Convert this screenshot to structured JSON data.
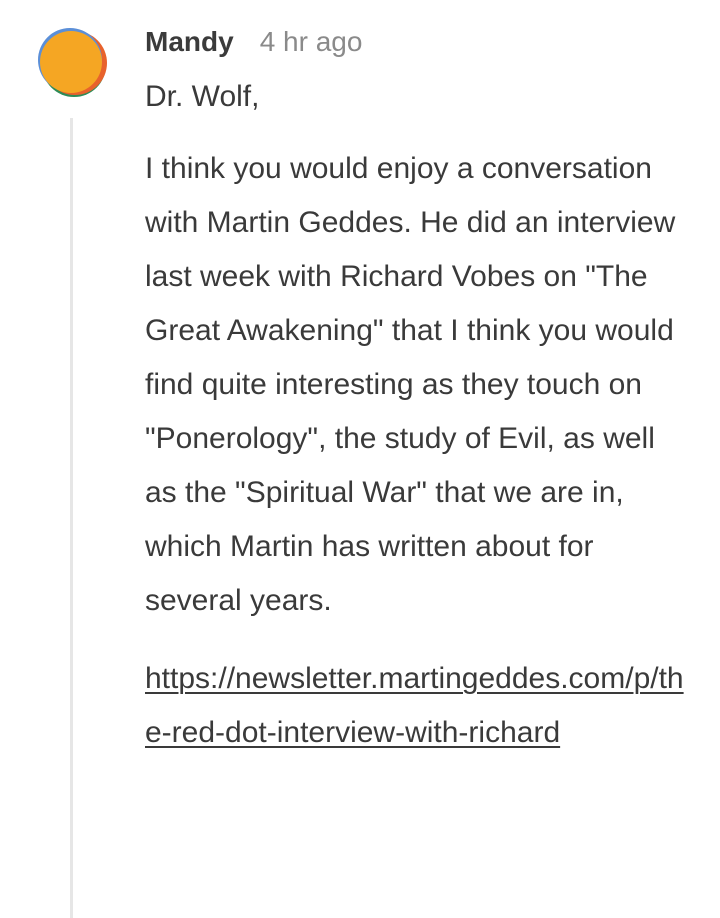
{
  "comment": {
    "author": "Mandy",
    "timestamp": "4 hr ago",
    "greeting": "Dr. Wolf,",
    "body": "I think you would enjoy a conversation with Martin Geddes. He did an interview last week with Richard Vobes on \"The Great Awakening\" that I think you would find quite interesting as they touch on \"Ponerology\", the study of Evil, as well as the \"Spiritual War\" that we are in, which Martin has written about for several years.",
    "link": "https://newsletter.martingeddes.com/p/the-red-dot-interview-with-richard",
    "avatar": {
      "icon": "user-avatar-icon",
      "colors": [
        "#f5a623",
        "#2e8b57",
        "#e8622c",
        "#5b8fd8"
      ]
    }
  }
}
